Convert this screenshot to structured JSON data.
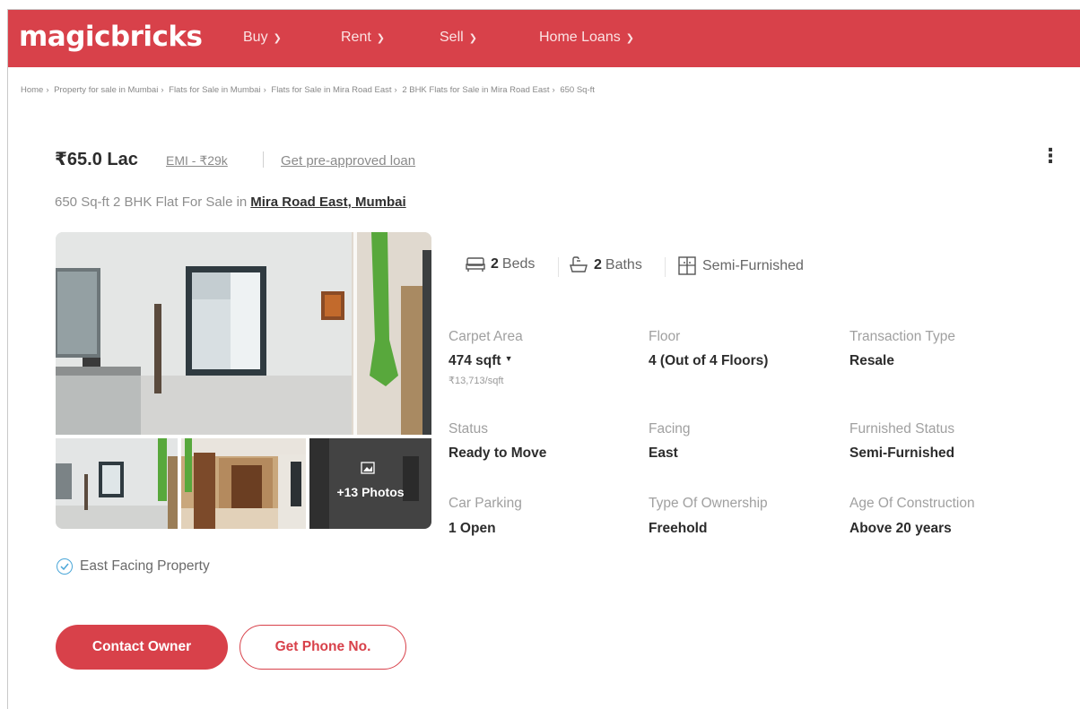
{
  "header": {
    "logo": "magicbricks",
    "nav": [
      {
        "label": "Buy"
      },
      {
        "label": "Rent"
      },
      {
        "label": "Sell"
      },
      {
        "label": "Home Loans"
      }
    ],
    "brand_color": "#d8414a"
  },
  "breadcrumb": [
    "Home",
    "Property for sale in Mumbai",
    "Flats for Sale in Mumbai",
    "Flats for Sale in Mira Road East",
    "2 BHK Flats for Sale in Mira Road East",
    "650 Sq-ft"
  ],
  "listing": {
    "price": "₹65.0 Lac",
    "emi": "EMI - ₹29k",
    "preapproved": "Get pre-approved loan",
    "subtitle": "650 Sq-ft 2 BHK Flat For Sale in",
    "location": "Mira Road East, Mumbai",
    "more_icon": "more-vertical-icon",
    "photos_label": "+13 Photos"
  },
  "features": {
    "beds_num": "2",
    "beds_label": "Beds",
    "baths_num": "2",
    "baths_label": "Baths",
    "furnishing": "Semi-Furnished"
  },
  "details": {
    "carpet_area": {
      "label": "Carpet Area",
      "value": "474 sqft",
      "sub": "₹13,713/sqft"
    },
    "floor": {
      "label": "Floor",
      "value": "4 (Out of 4 Floors)"
    },
    "transaction": {
      "label": "Transaction Type",
      "value": "Resale"
    },
    "status": {
      "label": "Status",
      "value": "Ready to Move"
    },
    "facing": {
      "label": "Facing",
      "value": "East"
    },
    "furnished": {
      "label": "Furnished Status",
      "value": "Semi-Furnished"
    },
    "parking": {
      "label": "Car Parking",
      "value": "1 Open"
    },
    "ownership": {
      "label": "Type Of Ownership",
      "value": "Freehold"
    },
    "age": {
      "label": "Age Of Construction",
      "value": "Above 20 years"
    }
  },
  "highlight": "East Facing Property",
  "actions": {
    "contact": "Contact Owner",
    "phone": "Get Phone No."
  }
}
